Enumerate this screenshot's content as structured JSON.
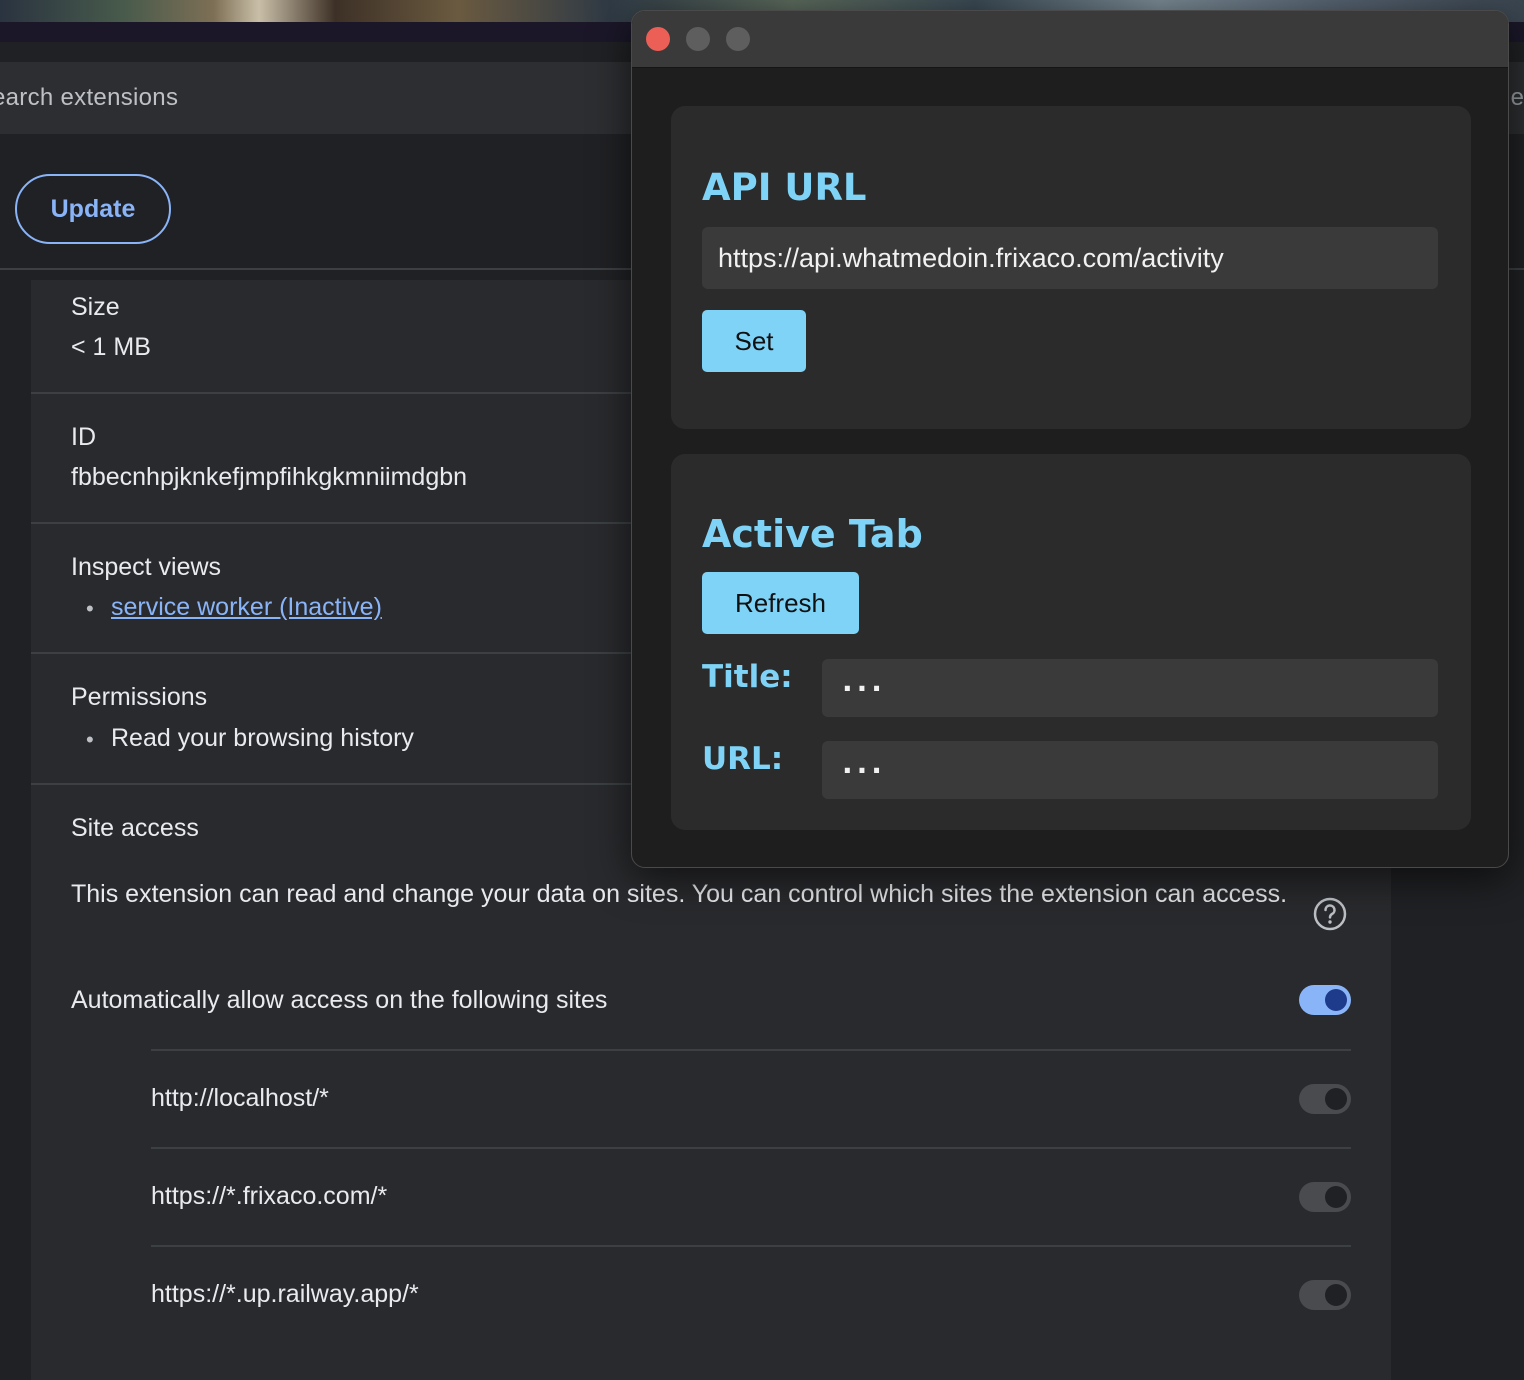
{
  "extensions_page": {
    "search": {
      "placeholder": "earch extensions"
    },
    "right_edge_glyph": "e",
    "toolbar": {
      "update_label": "Update"
    },
    "details": {
      "size": {
        "label": "Size",
        "value": "< 1 MB"
      },
      "id": {
        "label": "ID",
        "value": "fbbecnhpjknkefjmpfihkgkmniimdgbn"
      },
      "inspect_views": {
        "label": "Inspect views",
        "bullet": "•",
        "link": "service worker (Inactive)"
      },
      "permissions": {
        "label": "Permissions",
        "bullet": "•",
        "item": "Read your browsing history"
      },
      "site_access": {
        "label": "Site access",
        "description": "This extension can read and change your data on sites. You can control which sites the extension can access.",
        "auto_allow_label": "Automatically allow access on the following sites",
        "auto_allow_enabled": true,
        "sites": [
          {
            "pattern": "http://localhost/*",
            "enabled": false
          },
          {
            "pattern": "https://*.frixaco.com/*",
            "enabled": false
          },
          {
            "pattern": "https://*.up.railway.app/*",
            "enabled": false
          }
        ]
      }
    }
  },
  "popup": {
    "api_panel": {
      "title": "API URL",
      "url_value": "https://api.whatmedoin.frixaco.com/activity",
      "set_label": "Set"
    },
    "active_tab_panel": {
      "title": "Active Tab",
      "refresh_label": "Refresh",
      "title_label": "Title:",
      "title_value": "...",
      "url_label": "URL:",
      "url_value": "..."
    }
  },
  "colors": {
    "accent_blue": "#8ab4f8",
    "popup_accent": "#7fd3f7",
    "close_red": "#ec5f57",
    "page_background": "#202124",
    "card_background": "#292a2d"
  },
  "icons": [
    "help-icon",
    "window-close-icon",
    "window-minimize-icon",
    "window-maximize-icon"
  ]
}
